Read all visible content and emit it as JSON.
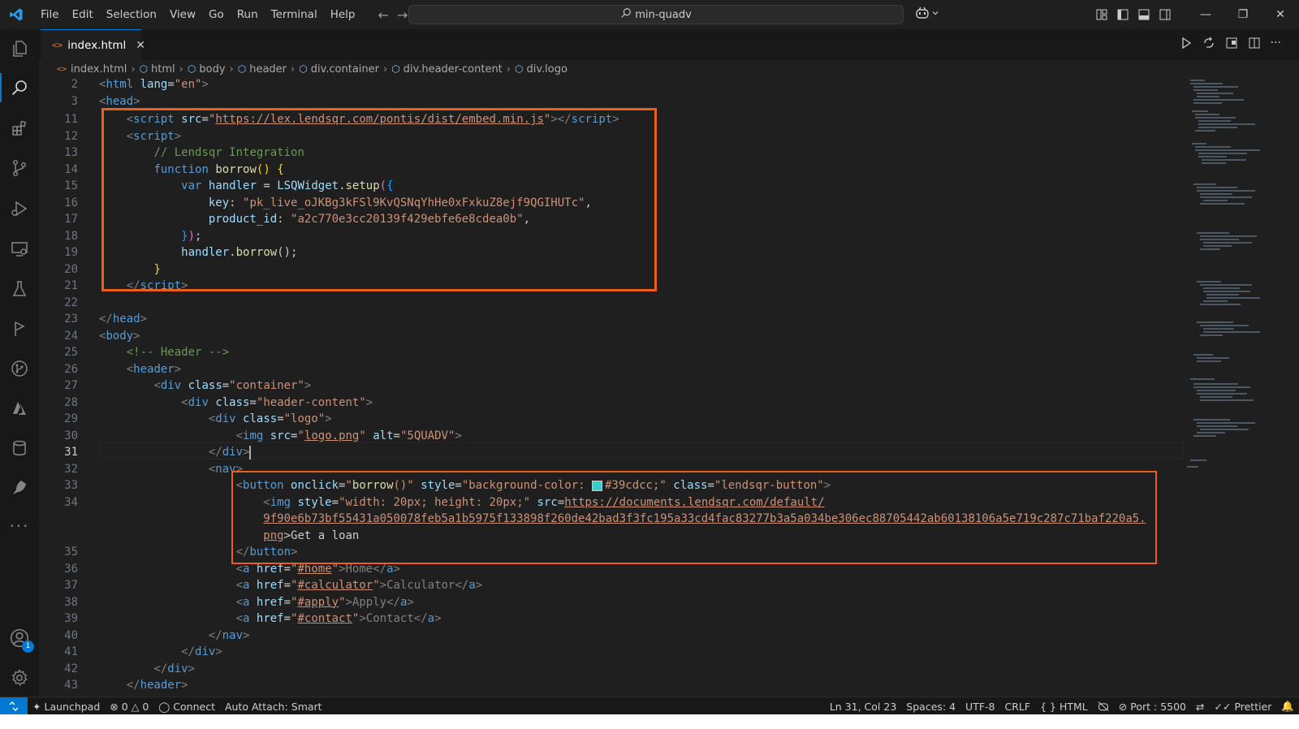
{
  "window": {
    "search_text": "min-quadv",
    "menu": [
      "File",
      "Edit",
      "Selection",
      "View",
      "Go",
      "Run",
      "Terminal",
      "Help"
    ]
  },
  "tab": {
    "filename": "index.html"
  },
  "breadcrumb": [
    "index.html",
    "html",
    "body",
    "header",
    "div.container",
    "div.header-content",
    "div.logo"
  ],
  "activity": {
    "accounts_badge": "1"
  },
  "colors": {
    "accent": "#0078d4",
    "highlight_box": "#e8601c",
    "swatch": "#39cdcc"
  },
  "code": {
    "l2": {
      "n": "2",
      "p": [
        "<",
        "html",
        " ",
        "lang",
        "=",
        "\"en\"",
        ">"
      ]
    },
    "l3": {
      "n": "3",
      "p": [
        "<",
        "head",
        ">"
      ]
    },
    "l11": {
      "n": "11",
      "p": [
        "    ",
        "<",
        "script",
        " ",
        "src",
        "=",
        "\"",
        "https://lex.lendsqr.com/pontis/dist/embed.min.js",
        "\"",
        "></",
        "script",
        ">"
      ]
    },
    "l12": {
      "n": "12",
      "p": [
        "    ",
        "<",
        "script",
        ">"
      ]
    },
    "l13": {
      "n": "13",
      "p": [
        "        ",
        "// Lendsqr Integration"
      ]
    },
    "l14": {
      "n": "14",
      "p": [
        "        ",
        "function",
        " ",
        "borrow",
        "()",
        " ",
        "{"
      ]
    },
    "l15": {
      "n": "15",
      "p": [
        "            ",
        "var",
        " ",
        "handler",
        " = ",
        "LSQWidget",
        ".",
        "setup",
        "(",
        "{"
      ]
    },
    "l16": {
      "n": "16",
      "p": [
        "                ",
        "key",
        ": ",
        "\"pk_live_oJKBg3kFSl9KvQSNqYhHe0xFxkuZ8ejf9QGIHUTc\"",
        ","
      ]
    },
    "l17": {
      "n": "17",
      "p": [
        "                ",
        "product_id",
        ": ",
        "\"a2c770e3cc20139f429ebfe6e8cdea0b\"",
        ","
      ]
    },
    "l18": {
      "n": "18",
      "p": [
        "            ",
        "}",
        ")",
        ";"
      ]
    },
    "l19": {
      "n": "19",
      "p": [
        "            ",
        "handler",
        ".",
        "borrow",
        "();"
      ]
    },
    "l20": {
      "n": "20",
      "p": [
        "        ",
        "}"
      ]
    },
    "l21": {
      "n": "21",
      "p": [
        "    ",
        "</",
        "script",
        ">"
      ]
    },
    "l22": {
      "n": "22"
    },
    "l23": {
      "n": "23",
      "p": [
        "</",
        "head",
        ">"
      ]
    },
    "l24": {
      "n": "24",
      "p": [
        "<",
        "body",
        ">"
      ]
    },
    "l25": {
      "n": "25",
      "p": [
        "    ",
        "<!-- Header -->"
      ]
    },
    "l26": {
      "n": "26",
      "p": [
        "    ",
        "<",
        "header",
        ">"
      ]
    },
    "l27": {
      "n": "27",
      "p": [
        "        ",
        "<",
        "div",
        " ",
        "class",
        "=",
        "\"container\"",
        ">"
      ]
    },
    "l28": {
      "n": "28",
      "p": [
        "            ",
        "<",
        "div",
        " ",
        "class",
        "=",
        "\"header-content\"",
        ">"
      ]
    },
    "l29": {
      "n": "29",
      "p": [
        "                ",
        "<",
        "div",
        " ",
        "class",
        "=",
        "\"logo\"",
        ">"
      ]
    },
    "l30": {
      "n": "30",
      "p": [
        "                    ",
        "<",
        "img",
        " ",
        "src",
        "=",
        "\"",
        "logo.png",
        "\"",
        " ",
        "alt",
        "=",
        "\"5QUADV\"",
        ">"
      ]
    },
    "l31": {
      "n": "31",
      "p": [
        "                ",
        "</",
        "div",
        ">"
      ]
    },
    "l32": {
      "n": "32",
      "p": [
        "                ",
        "<",
        "nav",
        ">"
      ]
    },
    "l33": {
      "n": "33",
      "p": [
        "                    ",
        "<",
        "button",
        " ",
        "onclick",
        "=",
        "\"",
        "borrow",
        "()\"",
        " ",
        "style",
        "=",
        "\"background-color: ",
        "#39cdcc;\"",
        " ",
        "class",
        "=",
        "\"lendsqr-button\"",
        ">"
      ]
    },
    "l34": {
      "n": "34",
      "p": [
        "                        ",
        "<",
        "img",
        " ",
        "style",
        "=",
        "\"width: 20px; height: 20px;\"",
        " ",
        "src",
        "=",
        "https://documents.lendsqr.com/default/"
      ]
    },
    "l34b": {
      "p": [
        "                        ",
        "9f90e6b73bf55431a050078feb5a1b5975f133898f260de42bad3f3fc195a33cd4fac83277b3a5a034be306ec88705442ab60138106a5e719c287c71baf220a5."
      ]
    },
    "l34c": {
      "p": [
        "                        ",
        "png",
        ">Get a loan"
      ]
    },
    "l35": {
      "n": "35",
      "p": [
        "                    ",
        "</",
        "button",
        ">"
      ]
    },
    "l36": {
      "n": "36",
      "p": [
        "                    ",
        "<",
        "a",
        " ",
        "href",
        "=",
        "\"",
        "#home",
        "\"",
        ">Home</",
        "a",
        ">"
      ]
    },
    "l37": {
      "n": "37",
      "p": [
        "                    ",
        "<",
        "a",
        " ",
        "href",
        "=",
        "\"",
        "#calculator",
        "\"",
        ">Calculator</",
        "a",
        ">"
      ]
    },
    "l38": {
      "n": "38",
      "p": [
        "                    ",
        "<",
        "a",
        " ",
        "href",
        "=",
        "\"",
        "#apply",
        "\"",
        ">Apply</",
        "a",
        ">"
      ]
    },
    "l39": {
      "n": "39",
      "p": [
        "                    ",
        "<",
        "a",
        " ",
        "href",
        "=",
        "\"",
        "#contact",
        "\"",
        ">Contact</",
        "a",
        ">"
      ]
    },
    "l40": {
      "n": "40",
      "p": [
        "                ",
        "</",
        "nav",
        ">"
      ]
    },
    "l41": {
      "n": "41",
      "p": [
        "            ",
        "</",
        "div",
        ">"
      ]
    },
    "l42": {
      "n": "42",
      "p": [
        "        ",
        "</",
        "div",
        ">"
      ]
    },
    "l43": {
      "n": "43",
      "p": [
        "    ",
        "</",
        "header",
        ">"
      ]
    }
  },
  "status": {
    "launchpad": "Launchpad",
    "errors": "0",
    "warnings": "0",
    "connect": "Connect",
    "auto_attach": "Auto Attach: Smart",
    "position": "Ln 31, Col 23",
    "spaces": "Spaces: 4",
    "encoding": "UTF-8",
    "eol": "CRLF",
    "language": "HTML",
    "port": "Port : 5500",
    "prettier": "Prettier"
  }
}
